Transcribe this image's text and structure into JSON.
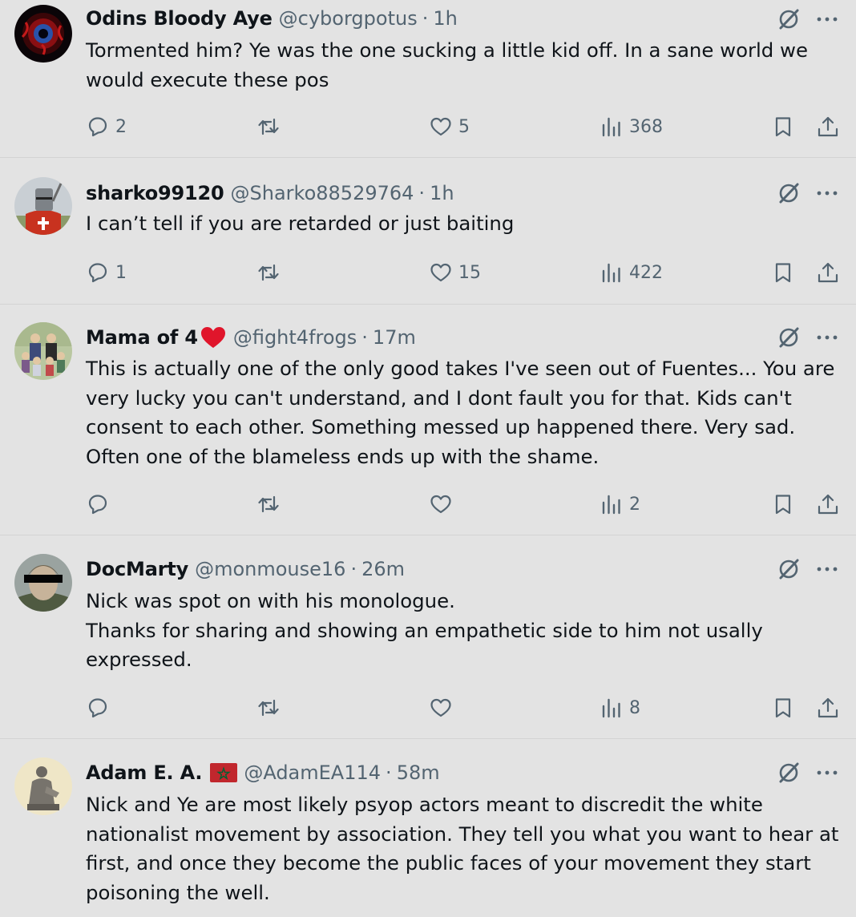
{
  "posts": [
    {
      "name": "Odins Bloody Aye",
      "handle": "@cyborgpotus",
      "separator": "·",
      "time": "1h",
      "avatar_icon": "bloody-eye-avatar",
      "body": [
        "Tormented him?  Ye was the one sucking a little kid off.  In a sane world we would execute these pos"
      ],
      "replies": "2",
      "reposts": "",
      "likes": "5",
      "views": "368"
    },
    {
      "name": "sharko99120",
      "handle": "@Sharko88529764",
      "separator": "·",
      "time": "1h",
      "avatar_icon": "crusader-knight-avatar",
      "body": [
        "I can’t tell if you are retarded or just baiting"
      ],
      "replies": "1",
      "reposts": "",
      "likes": "15",
      "views": "422"
    },
    {
      "name": "Mama of 4",
      "handle": "@fight4frogs",
      "separator": "·",
      "time": "17m",
      "avatar_icon": "family-painting-avatar",
      "body": [
        "This is actually one of the only good takes I've seen out of Fuentes... You are very lucky you can't understand, and I dont fault you for that. Kids can't consent to each other. Something messed up happened there.  Very sad. Often one of the blameless ends up with the shame."
      ],
      "replies": "",
      "reposts": "",
      "likes": "",
      "views": "2"
    },
    {
      "name": "DocMarty",
      "handle": "@monmouse16",
      "separator": "·",
      "time": "26m",
      "avatar_icon": "censored-face-avatar",
      "body": [
        "Nick was spot on with his monologue.",
        "Thanks for sharing and showing an empathetic side to him not usally expressed."
      ],
      "replies": "",
      "reposts": "",
      "likes": "",
      "views": "8"
    },
    {
      "name": "Adam E. A.",
      "handle": "@AdamEA114",
      "separator": "·",
      "time": "58m",
      "avatar_icon": "statue-avatar",
      "body": [
        "Nick and Ye are most likely psyop actors meant to discredit the white nationalist movement by association. They tell you what you want to hear at first, and once they become the public faces of your movement they start poisoning the well."
      ],
      "replies": "",
      "reposts": "",
      "likes": "",
      "views": ""
    }
  ],
  "colors": {
    "background": "#e3e3e3",
    "text": "#0f1419",
    "secondary": "#536471",
    "heart_red": "#e0152b",
    "flag_red": "#c1272d",
    "flag_green": "#006233"
  }
}
